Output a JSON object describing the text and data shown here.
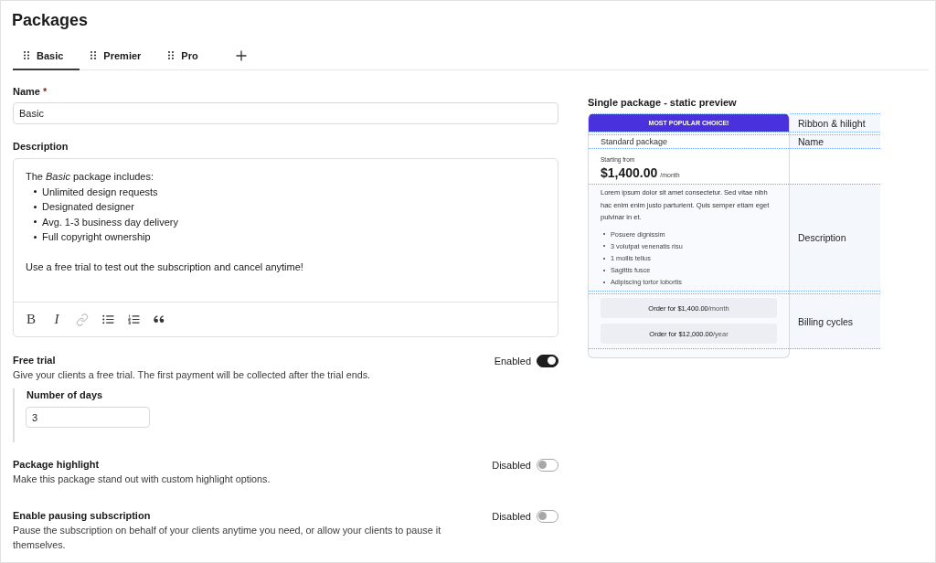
{
  "page": {
    "title": "Packages"
  },
  "tabs": [
    {
      "label": "Basic",
      "selected": true
    },
    {
      "label": "Premier",
      "selected": false
    },
    {
      "label": "Pro",
      "selected": false
    }
  ],
  "name_field": {
    "label": "Name",
    "required_mark": "*",
    "value": "Basic"
  },
  "description_field": {
    "label": "Description",
    "content": [
      {
        "kind": "paragraph",
        "text": "The *Basic* package includes:"
      },
      {
        "kind": "bullets",
        "items": [
          "Unlimited design requests",
          "Designated designer",
          "Avg. 1-3 business day delivery",
          "Full copyright ownership"
        ]
      },
      {
        "kind": "paragraph",
        "text": "Use a free trial to test out the subscription and cancel anytime!"
      }
    ],
    "toolbar": [
      {
        "kind": "bold",
        "label": "B",
        "disabled": false
      },
      {
        "kind": "italic",
        "label": "I",
        "disabled": false
      },
      {
        "kind": "link",
        "disabled": true
      },
      {
        "kind": "bullet-list",
        "disabled": false
      },
      {
        "kind": "numbered-list",
        "disabled": false
      },
      {
        "kind": "quote",
        "disabled": false
      }
    ]
  },
  "settings": [
    {
      "title": "Free trial",
      "description": "Give your clients a free trial. The first payment will be collected after the trial ends.",
      "status": "Enabled",
      "on": true,
      "subfield": {
        "label": "Number of days",
        "value": "3"
      }
    },
    {
      "title": "Package highlight",
      "description": "Make this package stand out with custom highlight options.",
      "status": "Disabled",
      "on": false
    },
    {
      "title": "Enable pausing subscription",
      "description": "Pause the subscription on behalf of your clients anytime you need, or allow your clients to pause it themselves.",
      "status": "Disabled",
      "on": false
    }
  ],
  "preview": {
    "title": "Single package - static preview",
    "ribbon": "MOST POPULAR CHOICE!",
    "package_name": "Standard package",
    "price_caption": "Starting from",
    "price": "$1,400.00",
    "period": "/month",
    "description": "Lorem ipsum dolor sit amet consectetur. Sed vitae nibh hac enim enim justo parturient. Quis semper etiam eget pulvinar in et.",
    "features": [
      "Posuere dignissim",
      "3 volutpat venenatis risu",
      "1 mollis tellus",
      "Sagittis fusce",
      "Adipiscing tortor lobortis"
    ],
    "order_buttons": [
      {
        "amount": "Order for $1,400.00",
        "period": "/month"
      },
      {
        "amount": "Order for $12,000.00",
        "period": "/year"
      }
    ],
    "annotations": [
      "Ribbon & hilight",
      "Name",
      "Description",
      "Billing cycles"
    ]
  }
}
